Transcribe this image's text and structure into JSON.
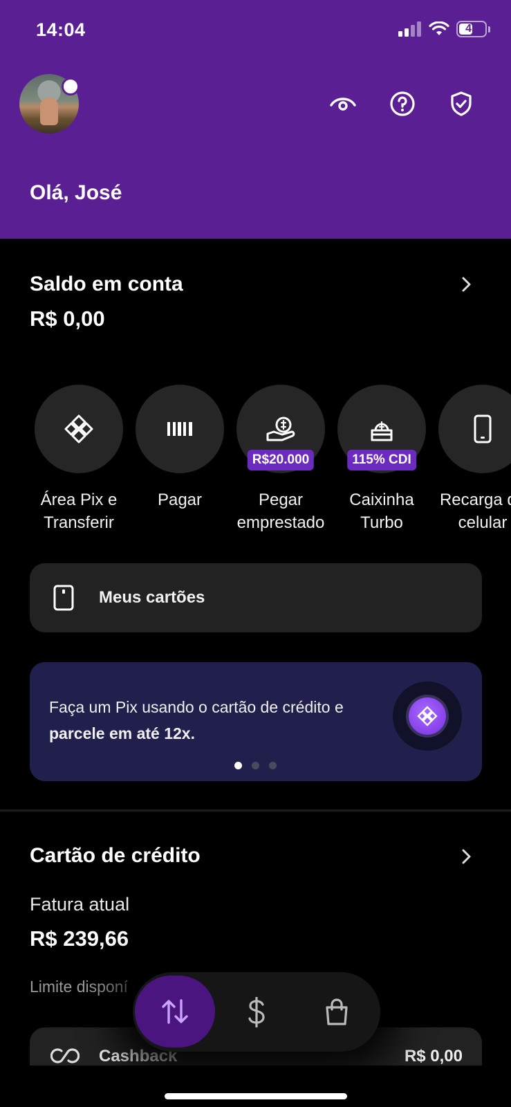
{
  "status_bar": {
    "time": "14:04",
    "battery": "47"
  },
  "header": {
    "greeting": "Olá, José"
  },
  "balance": {
    "title": "Saldo em conta",
    "amount": "R$ 0,00"
  },
  "actions": [
    {
      "label": "Área Pix e Transferir",
      "icon": "pix-icon",
      "badge": ""
    },
    {
      "label": "Pagar",
      "icon": "barcode-icon",
      "badge": ""
    },
    {
      "label": "Pegar emprestado",
      "icon": "loan-hand-icon",
      "badge": "R$20.000"
    },
    {
      "label": "Caixinha Turbo",
      "icon": "piggy-box-icon",
      "badge": "115% CDI"
    },
    {
      "label": "Recarga de celular",
      "icon": "phone-icon",
      "badge": ""
    }
  ],
  "cards_button": {
    "label": "Meus cartões"
  },
  "promo": {
    "text_regular": "Faça um Pix usando o cartão de crédito e ",
    "text_bold": "parcele em até 12x.",
    "pages": 3,
    "active_page": 1
  },
  "credit_card": {
    "title": "Cartão de crédito",
    "invoice_label": "Fatura atual",
    "invoice_amount": "R$ 239,66",
    "limit_label": "Limite disponí"
  },
  "cashback": {
    "label": "Cashback",
    "value": "R$ 0,00"
  },
  "tabbar": {
    "tabs": [
      "transfer-arrows-icon",
      "dollar-icon",
      "shopping-bag-icon"
    ],
    "active": 0
  },
  "colors": {
    "brand_purple": "#5b1f94",
    "badge_purple": "#6c2bbf",
    "promo_bg": "#21204d"
  }
}
